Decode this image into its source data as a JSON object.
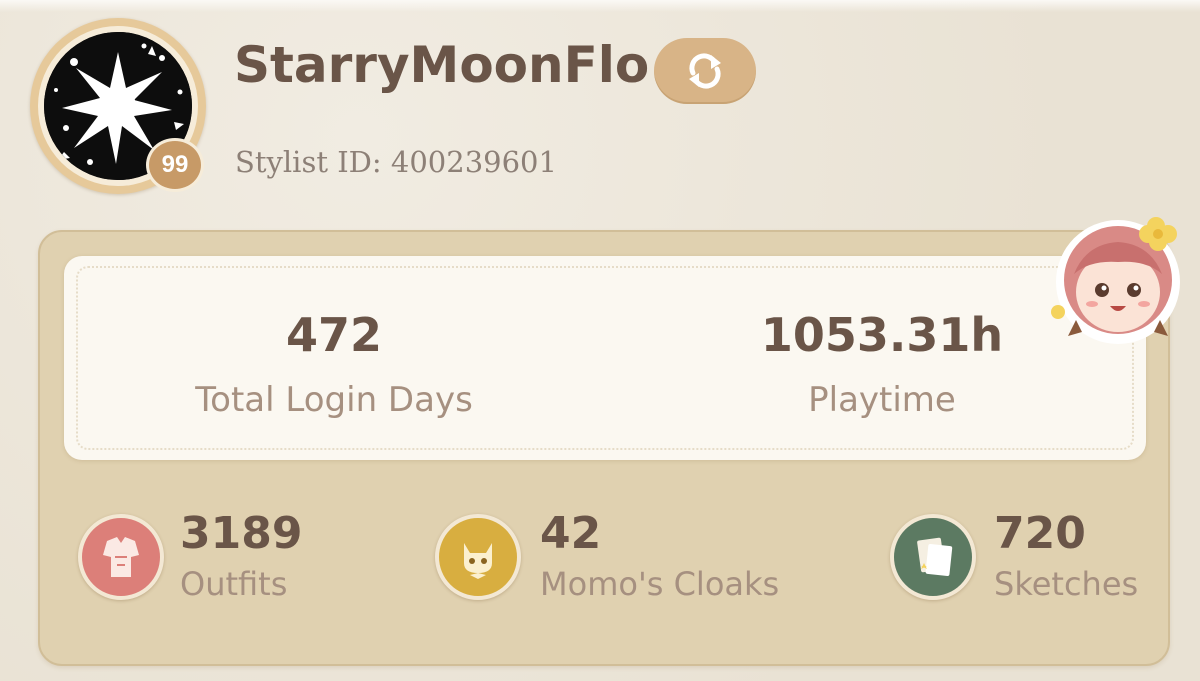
{
  "profile": {
    "username": "StarryMoonFlo",
    "level": "99",
    "stylist_id": "Stylist ID: 400239601",
    "avatar_icon": "starburst-avatar-icon",
    "swap_icon": "refresh-icon"
  },
  "summary": {
    "login_days_value": "472",
    "login_days_label": "Total Login Days",
    "playtime_value": "1053.31h",
    "playtime_label": "Playtime"
  },
  "stats": [
    {
      "value": "3189",
      "label": "Outfits",
      "icon": "outfits-icon",
      "color": "#dc7f79"
    },
    {
      "value": "42",
      "label": "Momo's Cloaks",
      "icon": "momo-cat-icon",
      "color": "#d8ae40"
    },
    {
      "value": "720",
      "label": "Sketches",
      "icon": "sketches-icon",
      "color": "#5c7a62"
    }
  ],
  "colors": {
    "text_dark": "#6a5548",
    "text_muted": "#a69080",
    "card_bg": "#e0d1b0",
    "accent": "#d8b487"
  }
}
